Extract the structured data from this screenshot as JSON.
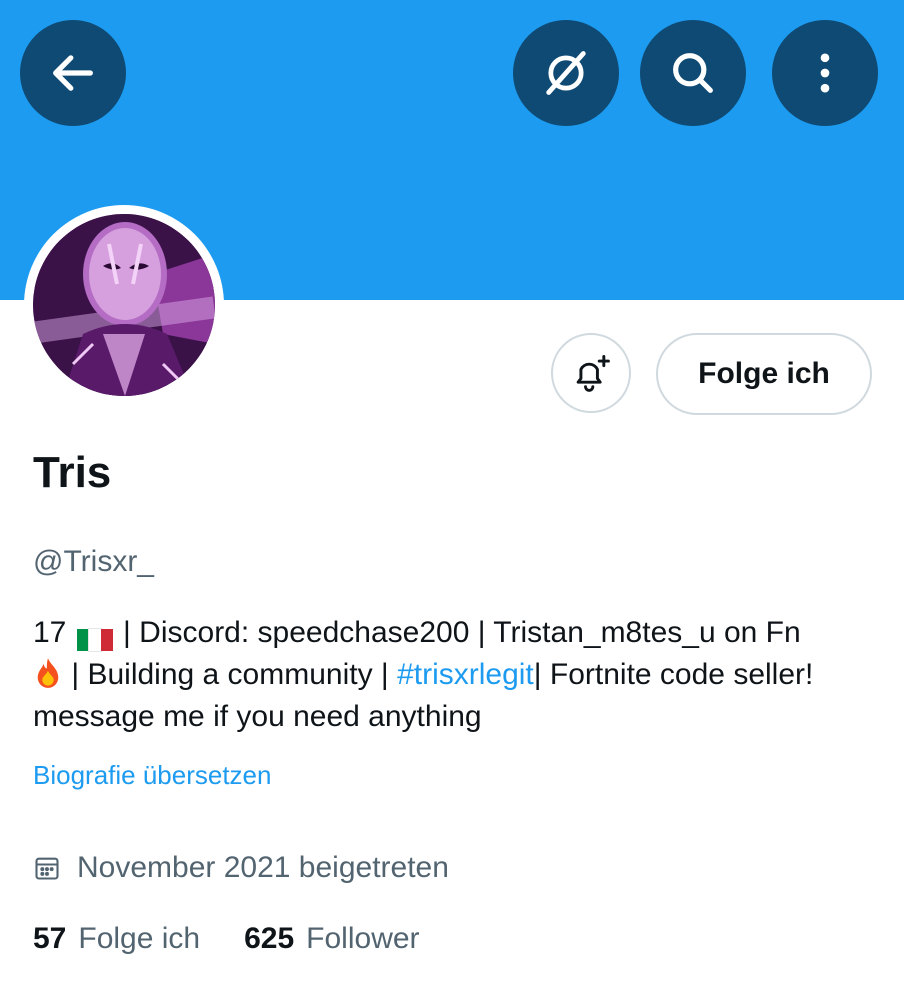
{
  "header": {
    "back_icon": "arrow-left-icon",
    "grok_icon": "grok-icon",
    "search_icon": "search-icon",
    "more_icon": "more-vertical-icon",
    "banner_color": "#1d9bf0",
    "button_color": "#0e4a73"
  },
  "profile": {
    "name": "Tris",
    "handle": "@Trisxr_",
    "follow_button": "Folge ich",
    "bell_icon": "notification-bell-plus-icon",
    "bio": {
      "part1": "17",
      "part2": " | Discord: speedchase200 | Tristan_m8tes_u on Fn ",
      "part3": " | Building a community | ",
      "hashtag": "#trisxrlegit",
      "part4": "| Fortnite code seller! message me if you need anything"
    },
    "translate_link": "Biografie übersetzen",
    "joined": "November 2021 beigetreten",
    "following_count": "57",
    "following_label": "Folge ich",
    "followers_count": "625",
    "followers_label": "Follower"
  }
}
